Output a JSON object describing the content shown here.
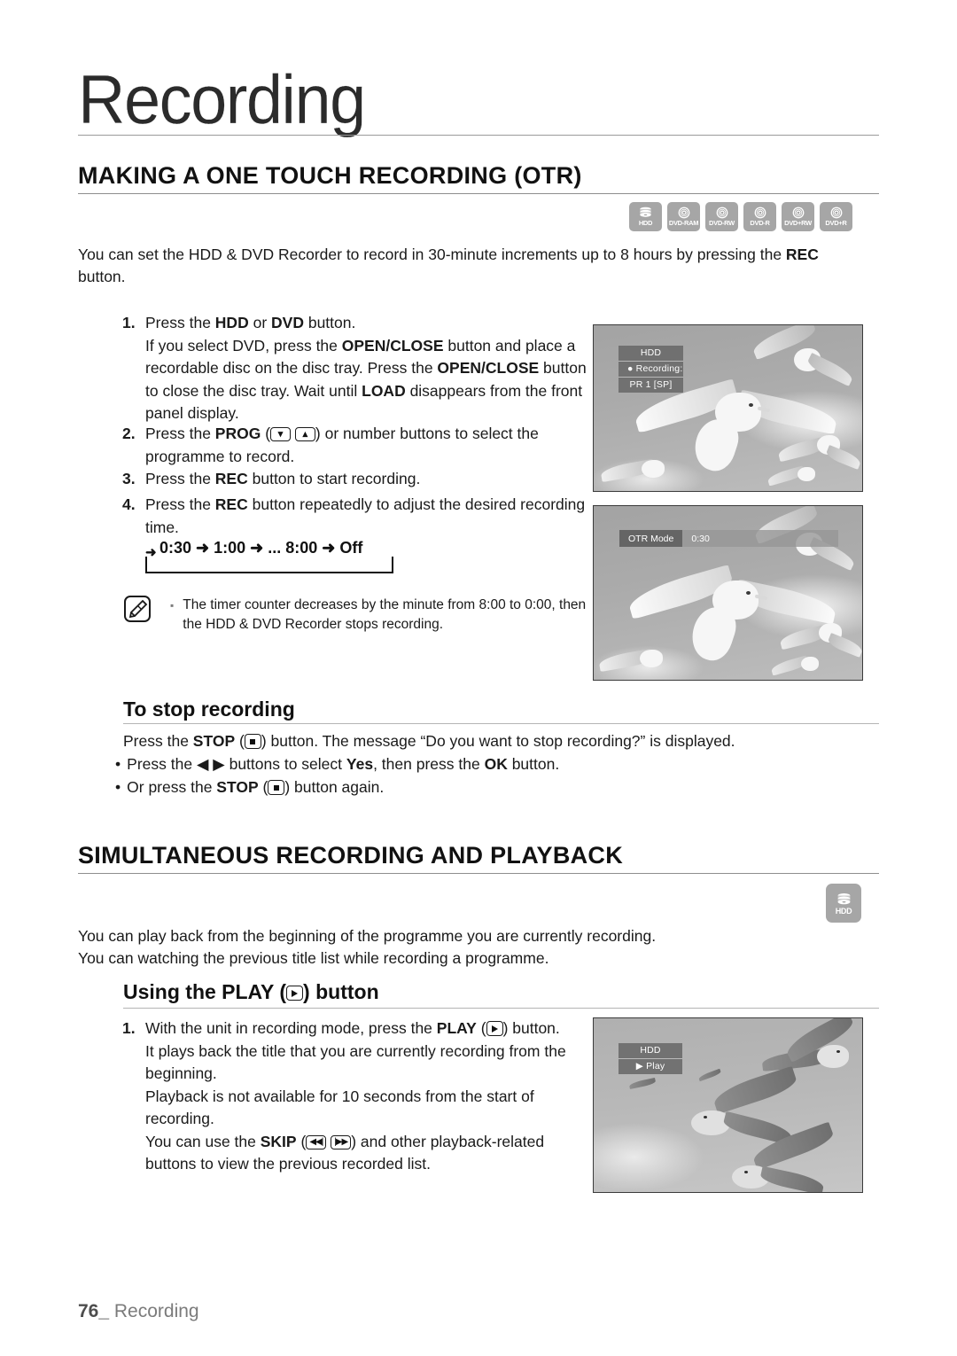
{
  "chapter": {
    "title": "Recording"
  },
  "footer": {
    "page_number": "76_",
    "label": "Recording"
  },
  "section1": {
    "heading": "MAKING A ONE TOUCH RECORDING (OTR)",
    "badges": [
      {
        "name": "HDD",
        "type": "hdd"
      },
      {
        "name": "DVD-RAM",
        "type": "disc"
      },
      {
        "name": "DVD-RW",
        "type": "disc"
      },
      {
        "name": "DVD-R",
        "type": "disc"
      },
      {
        "name": "DVD+RW",
        "type": "disc"
      },
      {
        "name": "DVD+R",
        "type": "disc"
      }
    ],
    "intro_1": "You can set the HDD & DVD Recorder to record in 30-minute increments up to 8 hours by pressing the ",
    "intro_bold": "REC",
    "intro_2": " button.",
    "steps": [
      {
        "num": "1.",
        "lines": [
          {
            "pre": "Press the ",
            "b1": "HDD",
            "mid": " or ",
            "b2": "DVD",
            "post": " button."
          },
          {
            "pre": "If you select DVD, press the ",
            "b1": "OPEN/CLOSE",
            "post": " button and place a"
          },
          {
            "pre": "recordable disc on the disc tray. Press the ",
            "b1": "OPEN/CLOSE",
            "post": " button"
          },
          {
            "pre": "to close the disc tray. Wait until ",
            "b1": "LOAD",
            "post": " disappears from the front"
          },
          {
            "pre": "panel display."
          }
        ]
      },
      {
        "num": "2.",
        "lines": [
          {
            "pre": "Press the ",
            "b1": "PROG",
            "icons": "prog",
            "post": " or number buttons to select the"
          },
          {
            "pre": "programme to record."
          }
        ]
      },
      {
        "num": "3.",
        "lines": [
          {
            "pre": "Press the ",
            "b1": "REC",
            "post": " button to start recording."
          }
        ]
      },
      {
        "num": "4.",
        "lines": [
          {
            "pre": "Press the ",
            "b1": "REC",
            "post": " button repeatedly to adjust the desired recording"
          },
          {
            "pre": "time."
          }
        ]
      }
    ],
    "sequence": {
      "items": [
        "0:30",
        "1:00",
        "...",
        "8:00",
        "Off"
      ],
      "arrow": "➜",
      "text": "0:30 ➜ 1:00 ➜ ... 8:00 ➜ Off"
    },
    "note": {
      "bullet": "▪",
      "line1": "The timer counter decreases by the minute from 8:00 to 0:00, then",
      "line2": "the HDD & DVD Recorder stops recording."
    },
    "stop_sub": {
      "heading": "To stop recording",
      "para_pre": "Press the ",
      "para_bold": "STOP",
      "para_post": " button. The message “Do you want to stop recording?” is displayed.",
      "bullets": [
        {
          "dot": "•",
          "pre": "Press the ",
          "arrows": "◀ ▶",
          "mid": " buttons to select ",
          "b1": "Yes",
          "mid2": ", then press the ",
          "b2": "OK",
          "post": " button."
        },
        {
          "dot": "•",
          "pre": "Or press the ",
          "b1": "STOP",
          "post": " button again."
        }
      ]
    },
    "shots": [
      {
        "id": "otr-recording-screen",
        "osd": {
          "type": "stack",
          "rows": [
            "HDD",
            "● Recording:",
            "PR 1 [SP]"
          ]
        }
      },
      {
        "id": "otr-mode-screen",
        "osd": {
          "type": "bar",
          "label": "OTR Mode",
          "value": "0:30"
        }
      }
    ]
  },
  "section2": {
    "heading": "SIMULTANEOUS RECORDING AND PLAYBACK",
    "badges": [
      {
        "name": "HDD",
        "type": "hdd"
      }
    ],
    "intro_line1": "You can play back from the beginning of the programme you are currently recording.",
    "intro_line2": "You can watching the previous title list while recording a programme.",
    "sub_heading_pre": "Using the PLAY (",
    "sub_heading_post": ") button",
    "steps": [
      {
        "num": "1.",
        "lines": [
          {
            "pre": "With the unit in recording mode, press the ",
            "b1": "PLAY",
            "icons": "play",
            "post": " button."
          },
          {
            "pre": "It plays back the title that you are currently recording from the"
          },
          {
            "pre": "beginning."
          },
          {
            "pre": "Playback is not available for 10 seconds from the start of"
          },
          {
            "pre": "recording."
          },
          {
            "pre": "You can use the ",
            "b1": "SKIP",
            "icons": "skip",
            "post": " and other playback-related"
          },
          {
            "pre": "buttons to view the previous recorded list."
          }
        ]
      }
    ],
    "shots": [
      {
        "id": "hdd-play-screen",
        "osd": {
          "type": "stack",
          "rows": [
            "HDD",
            "▶ Play"
          ]
        }
      }
    ]
  },
  "icons": {
    "prog_down": "chevron-down-icon",
    "prog_up": "chevron-up-icon",
    "stop": "stop-icon",
    "play": "play-icon",
    "skip_back": "skip-back-icon",
    "skip_fwd": "skip-forward-icon",
    "note": "note-pen-icon"
  },
  "colors": {
    "badge_gray": "#a6a6a6",
    "rule_gray": "#8e8e8e",
    "footer_gray": "#7b7b7b",
    "osd_gray": "#696969"
  }
}
